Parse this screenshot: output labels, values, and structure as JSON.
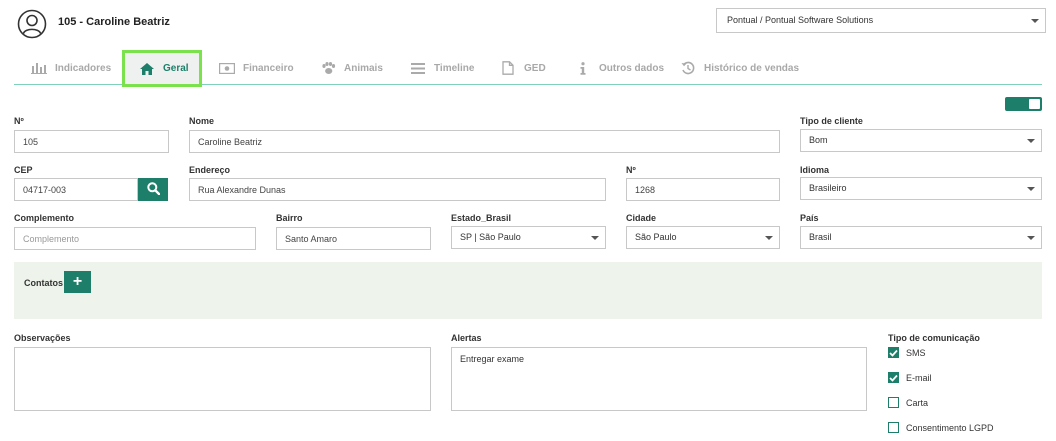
{
  "header": {
    "client_title": "105 - Caroline Beatriz",
    "company": "Pontual / Pontual Software Solutions"
  },
  "tabs": [
    {
      "label": "Indicadores",
      "icon": "bar-chart-icon"
    },
    {
      "label": "Geral",
      "icon": "home-icon",
      "active": true
    },
    {
      "label": "Financeiro",
      "icon": "money-icon"
    },
    {
      "label": "Animais",
      "icon": "paw-icon"
    },
    {
      "label": "Timeline",
      "icon": "list-icon"
    },
    {
      "label": "GED",
      "icon": "file-icon"
    },
    {
      "label": "Outros dados",
      "icon": "info-icon"
    },
    {
      "label": "Histórico de vendas",
      "icon": "history-icon"
    }
  ],
  "form": {
    "numero": {
      "label": "Nº",
      "value": "105"
    },
    "nome": {
      "label": "Nome",
      "value": "Caroline Beatriz"
    },
    "tipo_cliente": {
      "label": "Tipo de cliente",
      "value": "Bom"
    },
    "cep": {
      "label": "CEP",
      "value": "04717-003"
    },
    "endereco": {
      "label": "Endereço",
      "value": "Rua Alexandre Dunas"
    },
    "numero_end": {
      "label": "Nº",
      "value": "1268"
    },
    "idioma": {
      "label": "Idioma",
      "value": "Brasileiro"
    },
    "complemento": {
      "label": "Complemento",
      "placeholder": "Complemento"
    },
    "bairro": {
      "label": "Bairro",
      "value": "Santo Amaro"
    },
    "estado": {
      "label": "Estado_Brasil",
      "value": "SP | São Paulo"
    },
    "cidade": {
      "label": "Cidade",
      "value": "São Paulo"
    },
    "pais": {
      "label": "País",
      "value": "Brasil"
    }
  },
  "contacts": {
    "label": "Contatos",
    "add_symbol": "+"
  },
  "observacoes": {
    "label": "Observações",
    "value": ""
  },
  "alertas": {
    "label": "Alertas",
    "value": "Entregar exame"
  },
  "comunicacao": {
    "label": "Tipo de comunicação",
    "options": [
      {
        "label": "SMS",
        "checked": true
      },
      {
        "label": "E-mail",
        "checked": true
      },
      {
        "label": "Carta",
        "checked": false
      },
      {
        "label": "Consentimento LGPD",
        "checked": false
      }
    ]
  },
  "colors": {
    "accent": "#1d7f6a",
    "highlight": "#7be24d",
    "panel": "#eef4ec"
  }
}
